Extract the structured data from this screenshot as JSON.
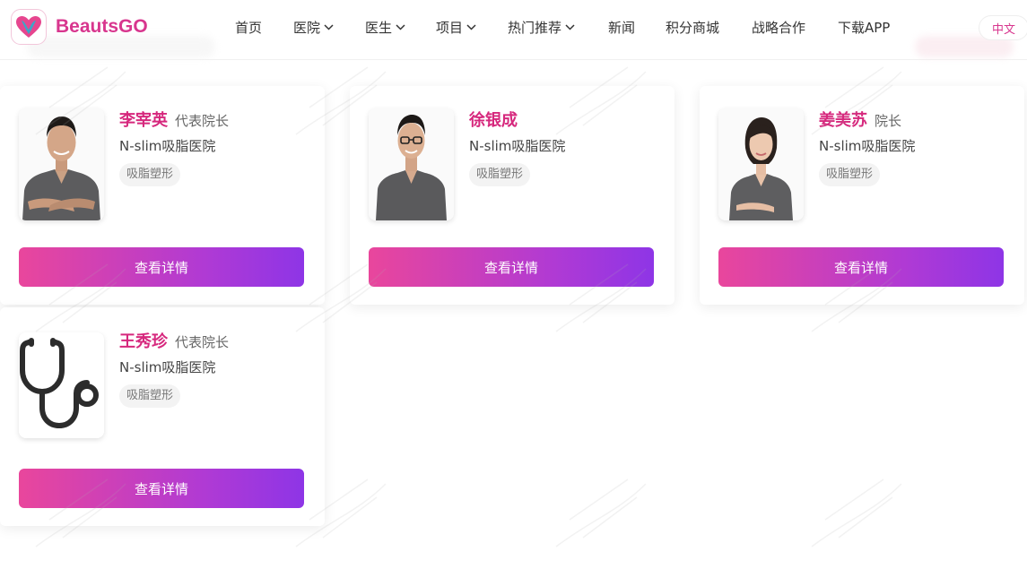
{
  "header": {
    "brand": "BeautsGO",
    "nav": [
      {
        "label": "首页",
        "has_dropdown": false
      },
      {
        "label": "医院",
        "has_dropdown": true
      },
      {
        "label": "医生",
        "has_dropdown": true
      },
      {
        "label": "项目",
        "has_dropdown": true
      },
      {
        "label": "热门推荐",
        "has_dropdown": true
      },
      {
        "label": "新闻",
        "has_dropdown": false
      },
      {
        "label": "积分商城",
        "has_dropdown": false
      },
      {
        "label": "战略合作",
        "has_dropdown": false
      },
      {
        "label": "下载APP",
        "has_dropdown": false
      }
    ],
    "language": "中文"
  },
  "doctors": [
    {
      "name": "李宰英",
      "title": "代表院长",
      "hospital": "N-slim吸脂医院",
      "tag": "吸脂塑形",
      "button": "查看详情",
      "photo": "doctor-photo-male"
    },
    {
      "name": "徐银成",
      "title": "",
      "hospital": "N-slim吸脂医院",
      "tag": "吸脂塑形",
      "button": "查看详情",
      "photo": "doctor-photo-male-glasses"
    },
    {
      "name": "姜美苏",
      "title": "院长",
      "hospital": "N-slim吸脂医院",
      "tag": "吸脂塑形",
      "button": "查看详情",
      "photo": "doctor-photo-female"
    },
    {
      "name": "王秀珍",
      "title": "代表院长",
      "hospital": "N-slim吸脂医院",
      "tag": "吸脂塑形",
      "button": "查看详情",
      "photo": "stethoscope-icon"
    }
  ],
  "colors": {
    "brand": "#d8368e",
    "name": "#d6287d",
    "button_gradient_start": "#e9469c",
    "button_gradient_end": "#8e35e6"
  }
}
